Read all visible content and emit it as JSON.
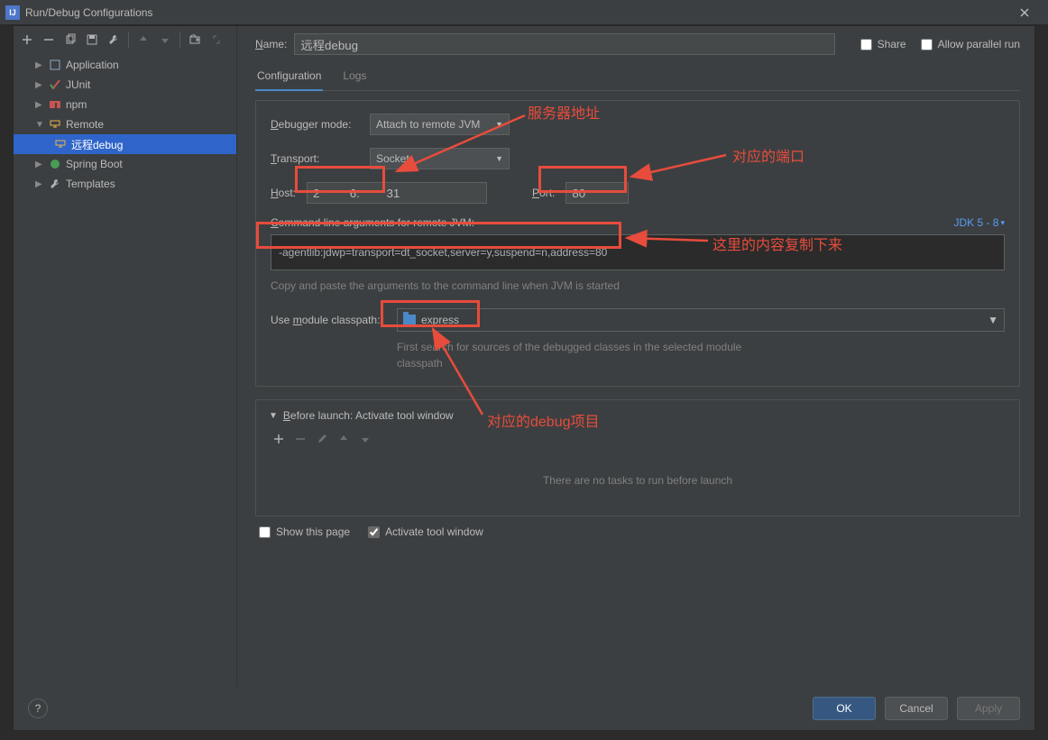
{
  "title": "Run/Debug Configurations",
  "toolbar_icons": [
    "add",
    "remove",
    "copy",
    "save",
    "wrench",
    "sep",
    "up",
    "down",
    "sep",
    "folder-move",
    "collapse"
  ],
  "tree": {
    "application": "Application",
    "junit": "JUnit",
    "npm": "npm",
    "remote": "Remote",
    "remote_child": "远程debug",
    "spring_boot": "Spring Boot",
    "templates": "Templates"
  },
  "name_label": "Name:",
  "name_value": "远程debug",
  "share_label": "Share",
  "parallel_label": "Allow parallel run",
  "tabs": {
    "config": "Configuration",
    "logs": "Logs"
  },
  "form": {
    "debugger_mode_label": "Debugger mode:",
    "debugger_mode_value": "Attach to remote JVM",
    "transport_label": "Transport:",
    "transport_value": "Socket",
    "host_label": "Host:",
    "host_value": "2         6.        31",
    "port_label": "Port:",
    "port_value": "80",
    "cmd_label": "Command line arguments for remote JVM:",
    "jdk_link": "JDK 5 - 8",
    "cmd_value": "-agentlib:jdwp=transport=dt_socket,server=y,suspend=n,address=80",
    "cmd_hint": "Copy and paste the arguments to the command line when JVM is started",
    "module_label": "Use module classpath:",
    "module_value": "express",
    "module_hint": "First search for sources of the debugged classes in the selected module classpath"
  },
  "before_launch": {
    "header": "Before launch: Activate tool window",
    "empty": "There are no tasks to run before launch"
  },
  "checks": {
    "show_page": "Show this page",
    "activate": "Activate tool window"
  },
  "buttons": {
    "ok": "OK",
    "cancel": "Cancel",
    "apply": "Apply"
  },
  "annotations": {
    "a1": "服务器地址",
    "a2": "对应的端口",
    "a3": "这里的内容复制下来",
    "a4": "对应的debug项目"
  }
}
